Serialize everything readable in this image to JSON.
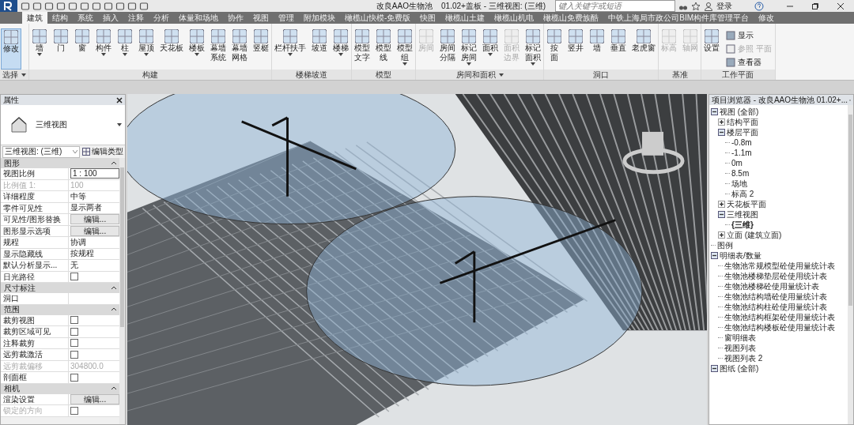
{
  "window": {
    "title": "改良AAO生物池    01.02+盖板 - 三维视图: (三维)",
    "search_placeholder": "键入关键字或短语",
    "login": "登录"
  },
  "tabs": [
    {
      "label": "建筑",
      "selected": true
    },
    {
      "label": "结构",
      "selected": false
    },
    {
      "label": "系统",
      "selected": false
    },
    {
      "label": "插入",
      "selected": false
    },
    {
      "label": "注释",
      "selected": false
    },
    {
      "label": "分析",
      "selected": false
    },
    {
      "label": "体量和场地",
      "selected": false
    },
    {
      "label": "协作",
      "selected": false
    },
    {
      "label": "视图",
      "selected": false
    },
    {
      "label": "管理",
      "selected": false
    },
    {
      "label": "附加模块",
      "selected": false
    },
    {
      "label": "橄榄山快模-免费版",
      "selected": false
    },
    {
      "label": "快图",
      "selected": false
    },
    {
      "label": "橄榄山土建",
      "selected": false
    },
    {
      "label": "橄榄山机电",
      "selected": false
    },
    {
      "label": "橄榄山免费族酷",
      "selected": false
    },
    {
      "label": "中铁上海局市政公司BIM构件库管理平台",
      "selected": false
    },
    {
      "label": "修改",
      "selected": false
    }
  ],
  "ribbon": [
    {
      "label": "选择",
      "menu": true,
      "tools": [
        {
          "label": "修改",
          "kind": "single",
          "dropdown": false,
          "disabled": false,
          "selected": true
        }
      ]
    },
    {
      "label": "构建",
      "menu": false,
      "tools": [
        {
          "label": "墙",
          "kind": "single",
          "dropdown": true,
          "disabled": false,
          "selected": false
        },
        {
          "label": "门",
          "kind": "single",
          "dropdown": false,
          "disabled": false,
          "selected": false
        },
        {
          "label": "窗",
          "kind": "single",
          "dropdown": false,
          "disabled": false,
          "selected": false
        },
        {
          "label": "构件",
          "kind": "single",
          "dropdown": true,
          "disabled": false,
          "selected": false
        },
        {
          "label": "柱",
          "kind": "single",
          "dropdown": true,
          "disabled": false,
          "selected": false
        },
        {
          "label": "屋顶",
          "kind": "single",
          "dropdown": true,
          "disabled": false,
          "selected": false
        },
        {
          "label": "天花板",
          "kind": "single",
          "dropdown": false,
          "disabled": false,
          "selected": false
        },
        {
          "label": "楼板",
          "kind": "single",
          "dropdown": true,
          "disabled": false,
          "selected": false
        },
        {
          "label": "幕墙系统",
          "kind": "double",
          "dropdown": false,
          "disabled": false,
          "selected": false
        },
        {
          "label": "幕墙网格",
          "kind": "double",
          "dropdown": false,
          "disabled": false,
          "selected": false
        },
        {
          "label": "竖梃",
          "kind": "single",
          "dropdown": false,
          "disabled": false,
          "selected": false
        }
      ]
    },
    {
      "label": "楼梯坡道",
      "menu": false,
      "tools": [
        {
          "label": "栏杆扶手",
          "kind": "single",
          "dropdown": true,
          "disabled": false,
          "selected": false
        },
        {
          "label": "坡道",
          "kind": "single",
          "dropdown": false,
          "disabled": false,
          "selected": false
        },
        {
          "label": "楼梯",
          "kind": "single",
          "dropdown": true,
          "disabled": false,
          "selected": false
        }
      ]
    },
    {
      "label": "模型",
      "menu": false,
      "tools": [
        {
          "label": "模型文字",
          "kind": "double",
          "dropdown": false,
          "disabled": false,
          "selected": false
        },
        {
          "label": "模型线",
          "kind": "double",
          "dropdown": false,
          "disabled": false,
          "selected": false
        },
        {
          "label": "模型组",
          "kind": "double",
          "dropdown": true,
          "disabled": false,
          "selected": false
        }
      ]
    },
    {
      "label": "房间和面积",
      "menu": true,
      "tools": [
        {
          "label": "房间",
          "kind": "single",
          "dropdown": false,
          "disabled": true,
          "selected": false
        },
        {
          "label": "房间分隔",
          "kind": "double",
          "dropdown": false,
          "disabled": false,
          "selected": false
        },
        {
          "label": "标记房间",
          "kind": "double",
          "dropdown": true,
          "disabled": false,
          "selected": false
        },
        {
          "label": "面积",
          "kind": "single",
          "dropdown": true,
          "disabled": false,
          "selected": false
        },
        {
          "label": "面积边界",
          "kind": "double",
          "dropdown": false,
          "disabled": true,
          "selected": false
        },
        {
          "label": "标记面积",
          "kind": "double",
          "dropdown": true,
          "disabled": false,
          "selected": false
        }
      ]
    },
    {
      "label": "洞口",
      "menu": false,
      "tools": [
        {
          "label": "按面",
          "kind": "double",
          "dropdown": false,
          "disabled": false,
          "selected": false
        },
        {
          "label": "竖井",
          "kind": "single",
          "dropdown": false,
          "disabled": false,
          "selected": false
        },
        {
          "label": "墙",
          "kind": "single",
          "dropdown": false,
          "disabled": false,
          "selected": false
        },
        {
          "label": "垂直",
          "kind": "single",
          "dropdown": false,
          "disabled": false,
          "selected": false
        },
        {
          "label": "老虎窗",
          "kind": "single",
          "dropdown": false,
          "disabled": false,
          "selected": false
        }
      ]
    },
    {
      "label": "基准",
      "menu": false,
      "tools": [
        {
          "label": "标高",
          "kind": "single",
          "dropdown": false,
          "disabled": true,
          "selected": false
        },
        {
          "label": "轴网",
          "kind": "single",
          "dropdown": false,
          "disabled": true,
          "selected": false
        }
      ]
    },
    {
      "label": "工作平面",
      "menu": false,
      "tools": [
        {
          "label": "设置",
          "kind": "single",
          "dropdown": false,
          "disabled": false,
          "selected": false
        }
      ],
      "small_tools": [
        {
          "label": "显示",
          "disabled": false
        },
        {
          "label": "参照 平面",
          "disabled": true
        },
        {
          "label": "查看器",
          "disabled": false
        }
      ]
    }
  ],
  "properties": {
    "title": "属性",
    "type_name": "三维视图",
    "selector": "三维视图: (三维)",
    "edit_type": "编辑类型",
    "groups": [
      {
        "name": "图形",
        "rows": [
          {
            "label": "视图比例",
            "kind": "input",
            "value": "1 : 100",
            "disabled": false
          },
          {
            "label": "比例值 1:",
            "kind": "text",
            "value": "100",
            "disabled": true
          },
          {
            "label": "详细程度",
            "kind": "text",
            "value": "中等",
            "disabled": false
          },
          {
            "label": "零件可见性",
            "kind": "text",
            "value": "显示两者",
            "disabled": false
          },
          {
            "label": "可见性/图形替换",
            "kind": "button",
            "value": "编辑...",
            "disabled": false
          },
          {
            "label": "图形显示选项",
            "kind": "button",
            "value": "编辑...",
            "disabled": false
          },
          {
            "label": "规程",
            "kind": "text",
            "value": "协调",
            "disabled": false
          },
          {
            "label": "显示隐藏线",
            "kind": "text",
            "value": "按规程",
            "disabled": false
          },
          {
            "label": "默认分析显示...",
            "kind": "text",
            "value": "无",
            "disabled": false
          },
          {
            "label": "日光路径",
            "kind": "checkbox",
            "checked": false,
            "disabled": false
          }
        ]
      },
      {
        "name": "尺寸标注",
        "rows": [
          {
            "label": "洞口",
            "kind": "text",
            "disabled": false
          }
        ]
      },
      {
        "name": "范围",
        "rows": [
          {
            "label": "裁剪视图",
            "kind": "checkbox",
            "checked": false,
            "disabled": false
          },
          {
            "label": "裁剪区域可见",
            "kind": "checkbox",
            "checked": false,
            "disabled": false
          },
          {
            "label": "注释裁剪",
            "kind": "checkbox",
            "checked": false,
            "disabled": false
          },
          {
            "label": "远剪裁激活",
            "kind": "checkbox",
            "checked": false,
            "disabled": false
          },
          {
            "label": "远剪裁偏移",
            "kind": "text",
            "value": "304800.0",
            "disabled": true
          },
          {
            "label": "剖面框",
            "kind": "checkbox",
            "checked": false,
            "disabled": false
          }
        ]
      },
      {
        "name": "相机",
        "rows": [
          {
            "label": "渲染设置",
            "kind": "button",
            "value": "编辑...",
            "disabled": false
          },
          {
            "label": "锁定的方向",
            "kind": "checkbox",
            "checked": false,
            "disabled": true
          }
        ]
      }
    ]
  },
  "browser": {
    "title": "项目浏览器 - 改良AAO生物池 01.02+...",
    "tree": [
      {
        "label": "视图 (全部)",
        "expanded": true,
        "current": false,
        "children": [
          {
            "label": "结构平面",
            "expanded": false,
            "current": false
          },
          {
            "label": "楼层平面",
            "expanded": true,
            "current": false,
            "children": [
              {
                "label": "-0.8m",
                "current": false
              },
              {
                "label": "-1.1m",
                "current": false
              },
              {
                "label": "0m",
                "current": false
              },
              {
                "label": "8.5m",
                "current": false
              },
              {
                "label": "场地",
                "current": false
              },
              {
                "label": "标高 2",
                "current": false
              }
            ]
          },
          {
            "label": "天花板平面",
            "expanded": false,
            "current": false
          },
          {
            "label": "三维视图",
            "expanded": true,
            "current": false,
            "children": [
              {
                "label": "{三维}",
                "current": true
              }
            ]
          },
          {
            "label": "立面 (建筑立面)",
            "expanded": false,
            "current": false
          }
        ]
      },
      {
        "label": "图例",
        "current": false
      },
      {
        "label": "明细表/数量",
        "expanded": true,
        "current": false,
        "children": [
          {
            "label": "生物池常规模型砼使用量统计表",
            "current": false
          },
          {
            "label": "生物池楼梯垫层砼使用统计表",
            "current": false
          },
          {
            "label": "生物池楼梯砼使用量统计表",
            "current": false
          },
          {
            "label": "生物池结构墙砼使用量统计表",
            "current": false
          },
          {
            "label": "生物池结构柱砼使用量统计表",
            "current": false
          },
          {
            "label": "生物池结构框架砼使用量统计表",
            "current": false
          },
          {
            "label": "生物池结构楼板砼使用量统计表",
            "current": false
          },
          {
            "label": "窗明细表",
            "current": false
          },
          {
            "label": "视图列表",
            "current": false
          },
          {
            "label": "视图列表 2",
            "current": false
          }
        ]
      },
      {
        "label": "图纸 (全部)",
        "expanded": true,
        "current": false
      }
    ]
  }
}
